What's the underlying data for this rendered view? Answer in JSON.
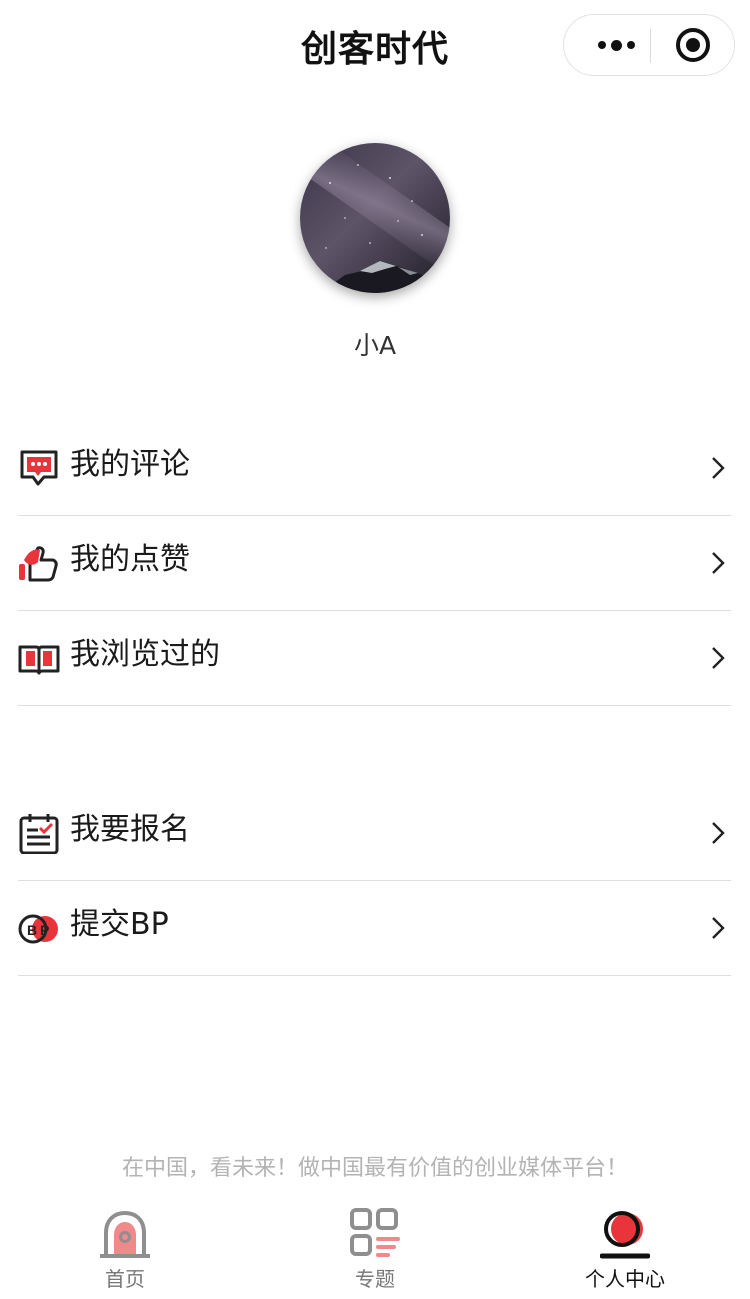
{
  "navbar": {
    "title": "创客时代",
    "capsule_menu_icon": "more-dots-icon",
    "capsule_close_icon": "target-circle-icon"
  },
  "profile": {
    "avatar_icon": "starry-night-avatar",
    "username": "小A"
  },
  "menu": {
    "group1": [
      {
        "label": "我的评论",
        "icon": "comment-bubble-icon"
      },
      {
        "label": "我的点赞",
        "icon": "thumbs-up-icon"
      },
      {
        "label": "我浏览过的",
        "icon": "open-book-icon"
      }
    ],
    "group2": [
      {
        "label": "我要报名",
        "icon": "clipboard-check-icon"
      },
      {
        "label": "提交BP",
        "icon": "bp-circle-icon"
      }
    ],
    "arrow_icon": "chevron-right-icon"
  },
  "footer": {
    "slogan": "在中国，看未来！做中国最有价值的创业媒体平台！"
  },
  "tabbar": {
    "tabs": [
      {
        "label": "首页",
        "icon": "home-alarm-icon",
        "active": false
      },
      {
        "label": "专题",
        "icon": "topics-grid-icon",
        "active": false
      },
      {
        "label": "个人中心",
        "icon": "profile-icon",
        "active": true
      }
    ]
  },
  "colors": {
    "accent": "#e8343a",
    "accent_light": "#f08a8a",
    "text": "#1a1a1a",
    "muted": "#b3b3b3",
    "divider": "#dedede"
  }
}
